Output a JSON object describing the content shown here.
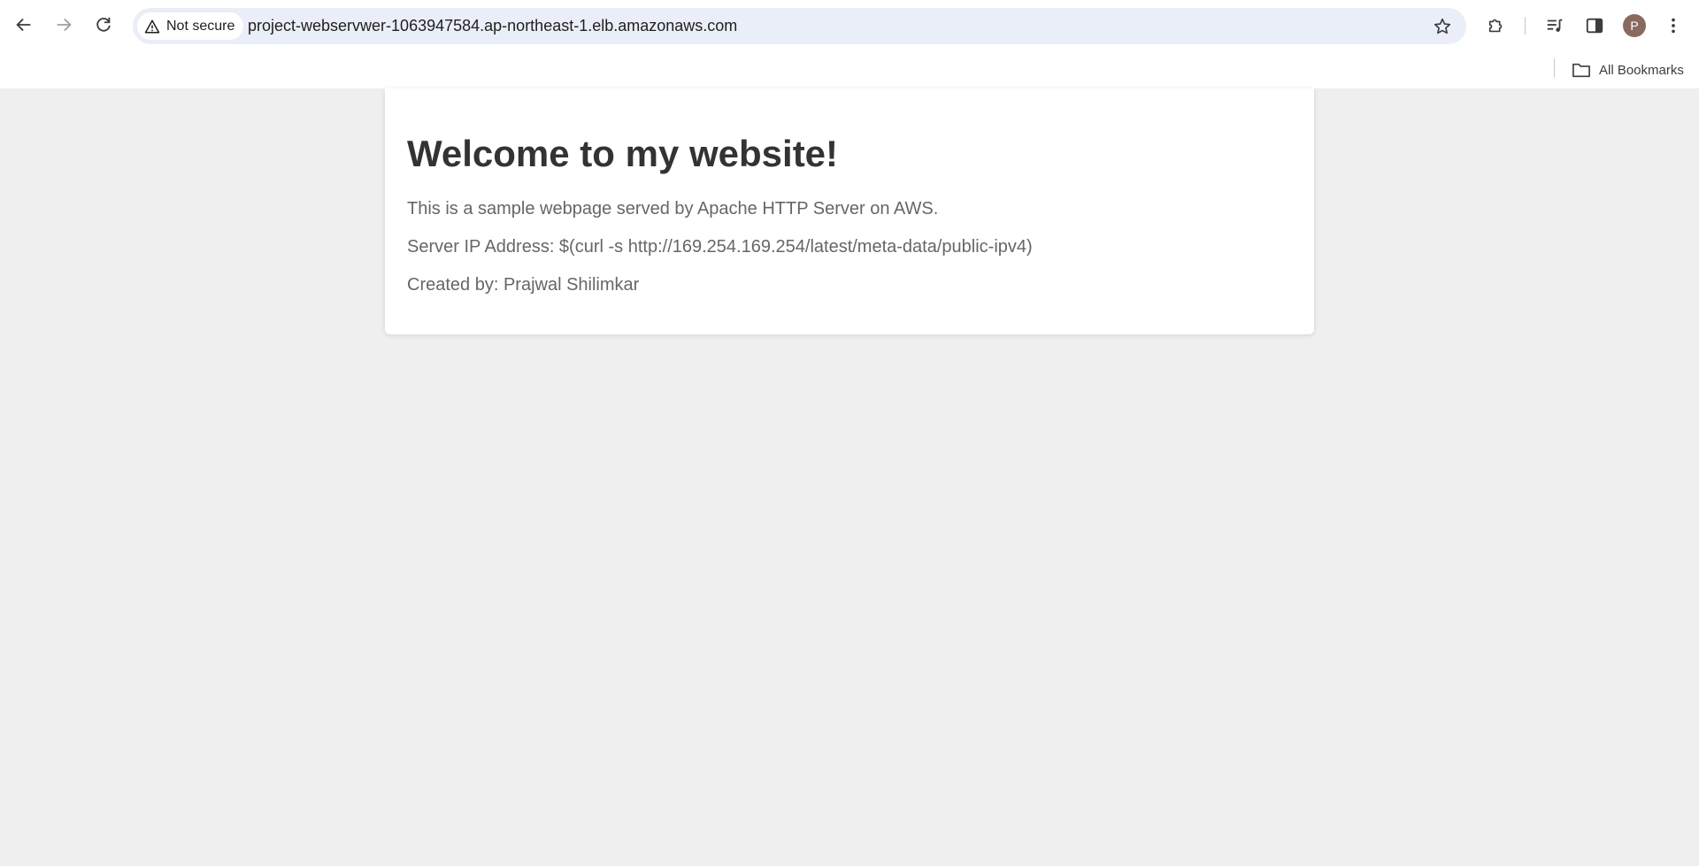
{
  "browser": {
    "security_label": "Not secure",
    "url": "project-webservwer-1063947584.ap-northeast-1.elb.amazonaws.com",
    "profile_initial": "P",
    "bookmarks_label": "All Bookmarks",
    "icons": {
      "back": "arrow-back-icon",
      "forward": "arrow-forward-icon",
      "reload": "reload-icon",
      "security": "warning-triangle-icon",
      "bookmark_star": "star-icon",
      "extensions": "puzzle-icon",
      "media": "media-queue-icon",
      "side_panel": "side-panel-icon",
      "menu": "kebab-menu-icon",
      "folder": "folder-icon"
    },
    "colors": {
      "omnibox_bg": "#eaeef8",
      "avatar_bg": "#8a6a60"
    }
  },
  "page": {
    "heading": "Welcome to my website!",
    "paragraphs": [
      "This is a sample webpage served by Apache HTTP Server on AWS.",
      "Server IP Address: $(curl -s http://169.254.169.254/latest/meta-data/public-ipv4)",
      "Created by: Prajwal Shilimkar"
    ],
    "colors": {
      "background": "#efefef",
      "card": "#ffffff",
      "heading": "#333333",
      "text": "#666666"
    }
  }
}
